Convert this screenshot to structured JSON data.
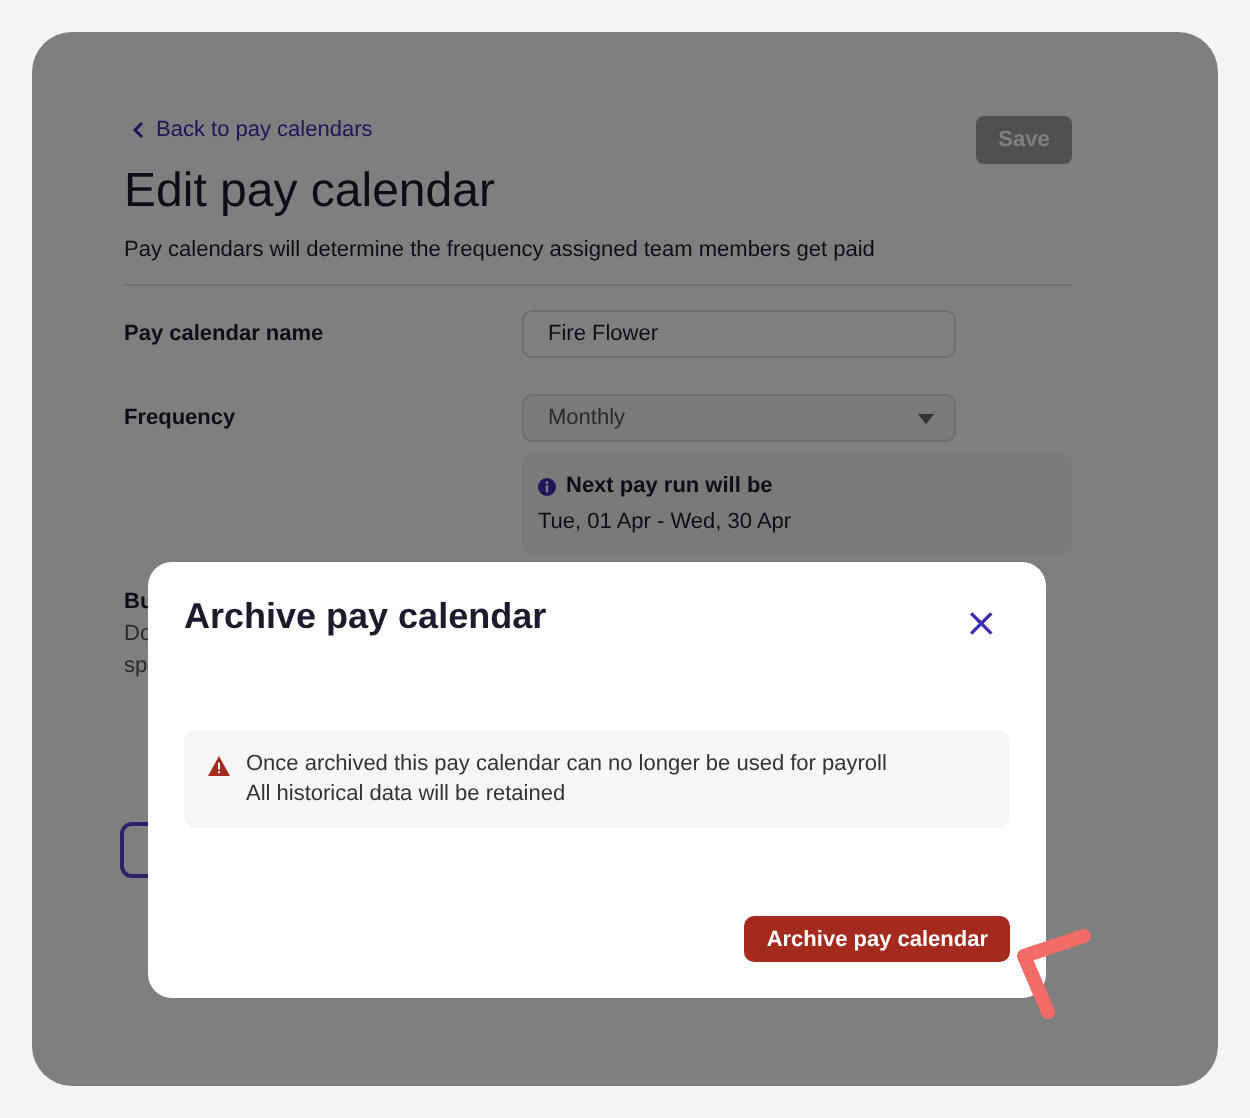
{
  "page": {
    "back_link": "Back to pay calendars",
    "save_button": {
      "label": "Save",
      "disabled": true
    },
    "title": "Edit pay calendar",
    "subtitle": "Pay calendars will determine the frequency assigned team members get paid",
    "fields": [
      {
        "label": "Pay calendar name",
        "kind": "text",
        "value": "Fire Flower"
      },
      {
        "label": "Frequency",
        "kind": "select",
        "value": "Monthly"
      }
    ],
    "info": {
      "title": "Next pay run will be",
      "text": "Tue, 01 Apr - Wed, 30 Apr"
    },
    "covered_section": {
      "heading": "Bu",
      "lines": [
        "Do",
        "sp"
      ]
    }
  },
  "dialog": {
    "title": "Archive pay calendar",
    "close": "×",
    "warning": [
      "Once archived this pay calendar can no longer be used for payroll",
      "All historical data will be retained"
    ],
    "confirm_button": "Archive pay calendar"
  }
}
